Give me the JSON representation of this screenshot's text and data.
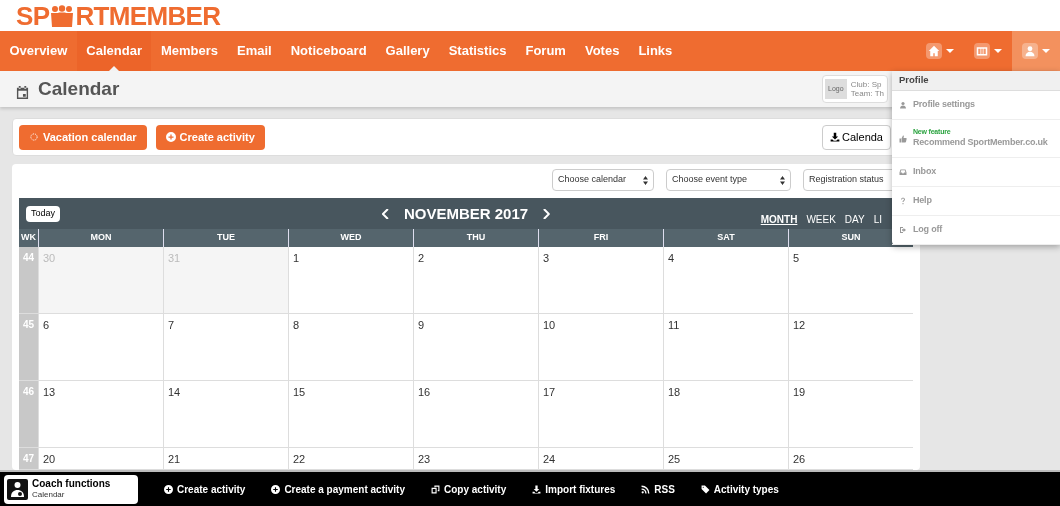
{
  "logo": {
    "before": "SP",
    "after": "RTMEMBER"
  },
  "nav": {
    "items": [
      {
        "label": "Overview",
        "selected": false
      },
      {
        "label": "Calendar",
        "selected": true
      },
      {
        "label": "Members",
        "selected": false
      },
      {
        "label": "Email",
        "selected": false
      },
      {
        "label": "Noticeboard",
        "selected": false
      },
      {
        "label": "Gallery",
        "selected": false
      },
      {
        "label": "Statistics",
        "selected": false
      },
      {
        "label": "Forum",
        "selected": false
      },
      {
        "label": "Votes",
        "selected": false
      },
      {
        "label": "Links",
        "selected": false
      }
    ],
    "icons": [
      {
        "kind": "home",
        "selected": false
      },
      {
        "kind": "team",
        "selected": false
      },
      {
        "kind": "user",
        "selected": true
      }
    ]
  },
  "page_header": {
    "title": "Calendar",
    "club_card": {
      "logo": "Logo",
      "club": "Club: Sp",
      "team": "Team: Th"
    }
  },
  "toolbar": {
    "buttons": [
      {
        "kind": "vacation",
        "label": "Vacation calendar"
      },
      {
        "kind": "create",
        "label": "Create activity"
      }
    ],
    "export_button": "Calenda"
  },
  "filters": [
    {
      "placeholder": "Choose calendar",
      "kind": "select"
    },
    {
      "placeholder": "Choose event type",
      "kind": "select"
    },
    {
      "placeholder": "Registration status",
      "kind": "plain"
    }
  ],
  "calendar": {
    "today_button": "Today",
    "month": "NOVEMBER 2017",
    "views": [
      {
        "label": "MONTH",
        "selected": true
      },
      {
        "label": "WEEK",
        "selected": false
      },
      {
        "label": "DAY",
        "selected": false
      },
      {
        "label": "LI",
        "selected": false
      }
    ],
    "wk_header": "WK",
    "days": [
      "MON",
      "TUE",
      "WED",
      "THU",
      "FRI",
      "SAT",
      "SUN"
    ],
    "weeks": [
      {
        "wk": "44",
        "dates": [
          {
            "d": "30",
            "other_month": true
          },
          {
            "d": "31",
            "other_month": true
          },
          {
            "d": "1",
            "other_month": false
          },
          {
            "d": "2",
            "other_month": false
          },
          {
            "d": "3",
            "other_month": false
          },
          {
            "d": "4",
            "other_month": false
          },
          {
            "d": "5",
            "other_month": false
          }
        ]
      },
      {
        "wk": "45",
        "dates": [
          {
            "d": "6",
            "other_month": false
          },
          {
            "d": "7",
            "other_month": false
          },
          {
            "d": "8",
            "other_month": false
          },
          {
            "d": "9",
            "other_month": false
          },
          {
            "d": "10",
            "other_month": false
          },
          {
            "d": "11",
            "other_month": false
          },
          {
            "d": "12",
            "other_month": false
          }
        ]
      },
      {
        "wk": "46",
        "dates": [
          {
            "d": "13",
            "other_month": false
          },
          {
            "d": "14",
            "other_month": false
          },
          {
            "d": "15",
            "other_month": false
          },
          {
            "d": "16",
            "other_month": false
          },
          {
            "d": "17",
            "other_month": false
          },
          {
            "d": "18",
            "other_month": false
          },
          {
            "d": "19",
            "other_month": false
          }
        ]
      },
      {
        "wk": "47",
        "dates": [
          {
            "d": "20",
            "other_month": false
          },
          {
            "d": "21",
            "other_month": false
          },
          {
            "d": "22",
            "other_month": false
          },
          {
            "d": "23",
            "other_month": false
          },
          {
            "d": "24",
            "other_month": false
          },
          {
            "d": "25",
            "other_month": false
          },
          {
            "d": "26",
            "other_month": false
          }
        ]
      }
    ]
  },
  "profile_menu": {
    "title": "Profile",
    "items": [
      {
        "kind": "user",
        "label": "Profile settings"
      },
      {
        "kind": "thumb",
        "label": "Recommend SportMember.co.uk",
        "badge": "New feature"
      },
      {
        "kind": "inbox",
        "label": "Inbox"
      },
      {
        "kind": "help",
        "label": "Help"
      },
      {
        "kind": "logoff",
        "label": "Log off"
      }
    ]
  },
  "coach_bar": {
    "card": {
      "title": "Coach functions",
      "subtitle": "Calendar"
    },
    "items": [
      {
        "kind": "plus",
        "label": "Create activity"
      },
      {
        "kind": "plus",
        "label": "Create a payment activity"
      },
      {
        "kind": "copy",
        "label": "Copy activity"
      },
      {
        "kind": "download",
        "label": "Import fixtures"
      },
      {
        "kind": "rss",
        "label": "RSS"
      },
      {
        "kind": "tag",
        "label": "Activity types"
      }
    ]
  }
}
